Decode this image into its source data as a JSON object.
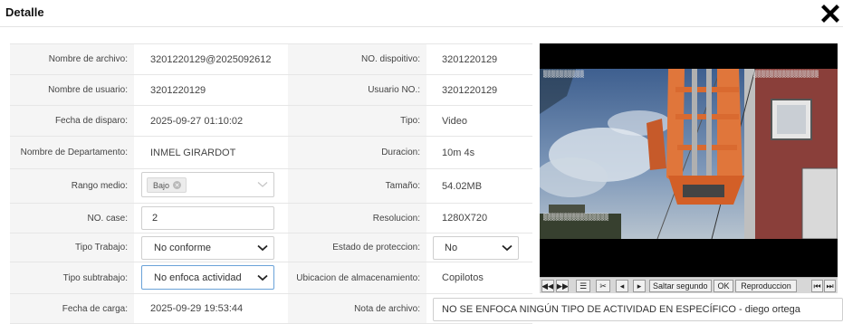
{
  "dialog": {
    "title": "Detalle"
  },
  "fields": {
    "nombre_archivo": {
      "label": "Nombre de archivo:",
      "value": "3201220129@2025092612"
    },
    "no_dispositivo": {
      "label": "NO. dispoitivo:",
      "value": "3201220129"
    },
    "nombre_usuario": {
      "label": "Nombre de usuario:",
      "value": "3201220129"
    },
    "usuario_no": {
      "label": "Usuario NO.:",
      "value": "3201220129"
    },
    "fecha_disparo": {
      "label": "Fecha de disparo:",
      "value": "2025-09-27 01:10:02"
    },
    "tipo": {
      "label": "Tipo:",
      "value": "Video"
    },
    "departamento": {
      "label": "Nombre de Departamento:",
      "value": "INMEL GIRARDOT"
    },
    "duracion": {
      "label": "Duracion:",
      "value": "10m 4s"
    },
    "rango_medio": {
      "label": "Rango medio:",
      "tag": "Bajo"
    },
    "tamano": {
      "label": "Tamaño:",
      "value": "54.02MB"
    },
    "no_case": {
      "label": "NO. case:",
      "value": "2"
    },
    "resolucion": {
      "label": "Resolucion:",
      "value": "1280X720"
    },
    "tipo_trabajo": {
      "label": "Tipo Trabajo:",
      "value": "No conforme"
    },
    "estado_proteccion": {
      "label": "Estado de proteccion:",
      "value": "No"
    },
    "tipo_subtrabajo": {
      "label": "Tipo subtrabajo:",
      "value": "No enfoca actividad"
    },
    "ubicacion": {
      "label": "Ubicacion de almacenamiento:",
      "value": "Copilotos"
    },
    "fecha_carga": {
      "label": "Fecha de carga:",
      "value": "2025-09-29 19:53:44"
    },
    "nota_archivo": {
      "label": "Nota de archivo:",
      "value": "NO SE ENFOCA NINGÚN TIPO DE ACTIVIDAD EN ESPECÍFICO - diego ortega"
    }
  },
  "player": {
    "jump_placeholder": "Saltar segundo",
    "ok_label": "OK",
    "playback_label": "Reproduccion"
  },
  "colors": {
    "focus_border": "#6aa2d8",
    "label_bg": "#f5f5f5",
    "video_bg": "#000000"
  }
}
